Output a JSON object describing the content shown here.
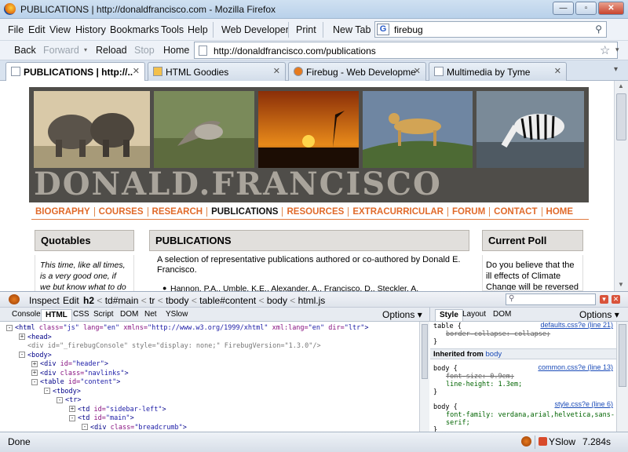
{
  "window": {
    "title": "PUBLICATIONS | http://donaldfrancisco.com - Mozilla Firefox"
  },
  "menu": [
    "File",
    "Edit",
    "View",
    "History",
    "Bookmarks",
    "Tools",
    "Help"
  ],
  "toolbar_menu": {
    "web_developer": "Web Developer",
    "print": "Print",
    "new_tab": "New Tab"
  },
  "search": {
    "engine": "G",
    "value": "firebug"
  },
  "nav": {
    "back": "Back",
    "forward": "Forward",
    "reload": "Reload",
    "stop": "Stop",
    "home": "Home",
    "url": "http://donaldfrancisco.com/publications"
  },
  "tabs": [
    {
      "label": "PUBLICATIONS | http://...",
      "active": true
    },
    {
      "label": "HTML Goodies",
      "active": false
    },
    {
      "label": "Firebug - Web Developme...",
      "active": false
    },
    {
      "label": "Multimedia by Tyme",
      "active": false
    }
  ],
  "page": {
    "banner_title": "DONALD.FRANCISCO",
    "site_nav": [
      "BIOGRAPHY",
      "COURSES",
      "RESEARCH",
      "PUBLICATIONS",
      "RESOURCES",
      "EXTRACURRICULAR",
      "FORUM",
      "CONTACT",
      "HOME"
    ],
    "quotables": {
      "heading": "Quotables",
      "text": "This time, like all times, is a very good one, if we but know what to do with it."
    },
    "publications": {
      "heading": "PUBLICATIONS",
      "intro": "A selection of representative publications authored or co-authored by Donald E. Francisco.",
      "first_item": "Hannon, P.A., Umble, K.E., Alexander, A., Francisco, D., Steckler, A."
    },
    "poll": {
      "heading": "Current Poll",
      "text": "Do you believe that the ill effects of Climate Change will be reversed"
    }
  },
  "firebug": {
    "toolbar": {
      "inspect": "Inspect",
      "edit": "Edit"
    },
    "breadcrumbs": [
      "h2",
      "td#main",
      "tr",
      "tbody",
      "table#content",
      "body",
      "html.js"
    ],
    "panels": [
      "Console",
      "HTML",
      "CSS",
      "Script",
      "DOM",
      "Net",
      "YSlow"
    ],
    "active_panel": "HTML",
    "options": "Options",
    "side_panels": [
      "Style",
      "Layout",
      "DOM"
    ],
    "html_lines": [
      {
        "indent": 0,
        "toggle": "-",
        "parts": [
          [
            "tag",
            "<html "
          ],
          [
            "atn",
            "class="
          ],
          [
            "atv",
            "\"js\""
          ],
          [
            "atn",
            " lang="
          ],
          [
            "atv",
            "\"en\""
          ],
          [
            "atn",
            " xmlns="
          ],
          [
            "atv",
            "\"http://www.w3.org/1999/xhtml\""
          ],
          [
            "atn",
            " xml:lang="
          ],
          [
            "atv",
            "\"en\""
          ],
          [
            "atn",
            " dir="
          ],
          [
            "atv",
            "\"ltr\""
          ],
          [
            "tag",
            ">"
          ]
        ]
      },
      {
        "indent": 1,
        "toggle": "+",
        "parts": [
          [
            "tag",
            "<head>"
          ]
        ]
      },
      {
        "indent": 1,
        "toggle": "",
        "parts": [
          [
            "gray",
            "<div id=\"_firebugConsole\" style=\"display: none;\" FirebugVersion=\"1.3.0\"/>"
          ]
        ]
      },
      {
        "indent": 1,
        "toggle": "-",
        "parts": [
          [
            "tag",
            "<body>"
          ]
        ]
      },
      {
        "indent": 2,
        "toggle": "+",
        "parts": [
          [
            "tag",
            "<div "
          ],
          [
            "atn",
            "id="
          ],
          [
            "atv",
            "\"header\""
          ],
          [
            "tag",
            ">"
          ]
        ]
      },
      {
        "indent": 2,
        "toggle": "+",
        "parts": [
          [
            "tag",
            "<div "
          ],
          [
            "atn",
            "class="
          ],
          [
            "atv",
            "\"navlinks\""
          ],
          [
            "tag",
            ">"
          ]
        ]
      },
      {
        "indent": 2,
        "toggle": "-",
        "parts": [
          [
            "tag",
            "<table "
          ],
          [
            "atn",
            "id="
          ],
          [
            "atv",
            "\"content\""
          ],
          [
            "tag",
            ">"
          ]
        ]
      },
      {
        "indent": 3,
        "toggle": "-",
        "parts": [
          [
            "tag",
            "<tbody>"
          ]
        ]
      },
      {
        "indent": 4,
        "toggle": "-",
        "parts": [
          [
            "tag",
            "<tr>"
          ]
        ]
      },
      {
        "indent": 5,
        "toggle": "+",
        "parts": [
          [
            "tag",
            "<td "
          ],
          [
            "atn",
            "id="
          ],
          [
            "atv",
            "\"sidebar-left\""
          ],
          [
            "tag",
            ">"
          ]
        ]
      },
      {
        "indent": 5,
        "toggle": "-",
        "parts": [
          [
            "tag",
            "<td "
          ],
          [
            "atn",
            "id="
          ],
          [
            "atv",
            "\"main\""
          ],
          [
            "tag",
            ">"
          ]
        ]
      },
      {
        "indent": 6,
        "toggle": "-",
        "parts": [
          [
            "tag",
            "<div "
          ],
          [
            "atn",
            "class="
          ],
          [
            "atv",
            "\"breadcrumb\""
          ],
          [
            "tag",
            ">"
          ]
        ]
      }
    ],
    "style": {
      "rule1_selector": "table {",
      "rule1_source": "defaults.css?e (line 21)",
      "rule1_prop": "border-collapse: collapse;",
      "rule1_close": "}",
      "inherited_label": "Inherited from",
      "inherited_target": "body",
      "rule2_selector": "body {",
      "rule2_source": "common.css?e (line 13)",
      "rule2_prop1": "font-size: 0.9em;",
      "rule2_prop2": "line-height: 1.3em;",
      "rule2_close": "}",
      "rule3_selector": "body {",
      "rule3_source": "style.css?e (line 6)",
      "rule3_prop1": "font-family: verdana,arial,helvetica,sans-",
      "rule3_prop1b": "serif;",
      "rule3_close": "}"
    }
  },
  "status": {
    "text": "Done",
    "yslow": "YSlow",
    "time": "7.284s"
  }
}
